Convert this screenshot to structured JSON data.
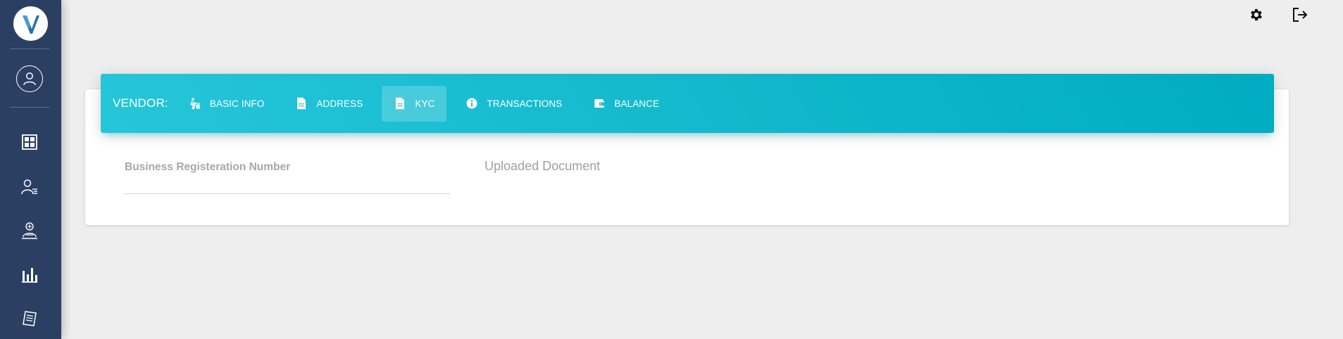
{
  "sidebar": {
    "logo_letter": "V",
    "icons": [
      "profile-icon",
      "dashboard-grid-icon",
      "user-list-icon",
      "vendor-icon",
      "bar-chart-icon",
      "report-document-icon"
    ]
  },
  "topbar": {
    "icons": [
      "gear-icon",
      "logout-icon"
    ]
  },
  "tabbar": {
    "label": "VENDOR:",
    "tabs": [
      {
        "label": "BASIC INFO",
        "icon": "person-walking-icon"
      },
      {
        "label": "ADDRESS",
        "icon": "document-icon"
      },
      {
        "label": "KYC",
        "icon": "document-icon",
        "active": true
      },
      {
        "label": "TRANSACTIONS",
        "icon": "info-icon"
      },
      {
        "label": "BALANCE",
        "icon": "wallet-icon"
      }
    ]
  },
  "content": {
    "field_label": "Business Registeration Number",
    "field_value": "",
    "document_label": "Uploaded Document"
  },
  "colors": {
    "sidebar": "#2b3f63",
    "tabbar_start": "#26c6da",
    "tabbar_end": "#00acc1",
    "background": "#eeeeee"
  }
}
